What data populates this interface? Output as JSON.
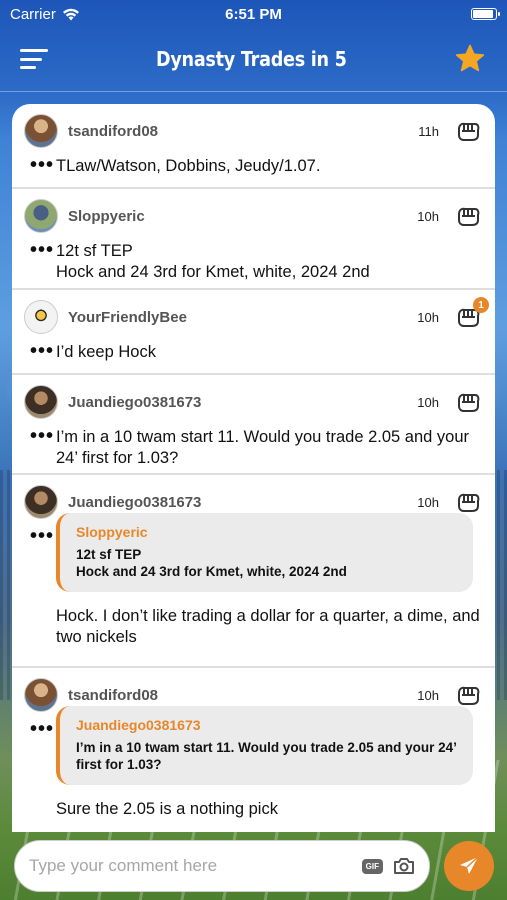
{
  "status_bar": {
    "carrier": "Carrier",
    "time": "6:51 PM"
  },
  "nav": {
    "title": "Dynasty Trades in 5",
    "menu_icon": "hamburger-menu-icon",
    "favorite_icon": "star-icon"
  },
  "colors": {
    "accent": "#e8872a",
    "header": "#2a62c0",
    "star": "#f5a623"
  },
  "posts": [
    {
      "username": "tsandiford08",
      "time": "11h",
      "text": "TLaw/Watson, Dobbins, Jeudy/1.07."
    },
    {
      "username": "Sloppyeric",
      "time": "10h",
      "text": "12t sf TEP\nHock and 24 3rd for Kmet, white, 2024 2nd"
    },
    {
      "username": "YourFriendlyBee",
      "time": "10h",
      "text": "I’d keep Hock",
      "reaction_count": "1"
    },
    {
      "username": "Juandiego0381673",
      "time": "10h",
      "text": "I’m in a 10 twam start 11.  Would you trade 2.05 and your 24’ first for 1.03?"
    },
    {
      "username": "Juandiego0381673",
      "time": "10h",
      "quote": {
        "username": "Sloppyeric",
        "text": "12t sf TEP\nHock and 24 3rd for Kmet, white, 2024 2nd"
      },
      "text": "Hock.  I don’t like trading a dollar for a quarter, a dime, and two nickels"
    },
    {
      "username": "tsandiford08",
      "time": "10h",
      "quote": {
        "username": "Juandiego0381673",
        "text": "I’m in a 10 twam start 11.  Would you trade 2.05 and your 24’ first for 1.03?"
      },
      "text": "Sure the 2.05 is a nothing pick"
    }
  ],
  "comment": {
    "placeholder": "Type your comment here",
    "gif_label": "GIF",
    "camera_icon": "camera-icon",
    "send_icon": "send-icon"
  }
}
